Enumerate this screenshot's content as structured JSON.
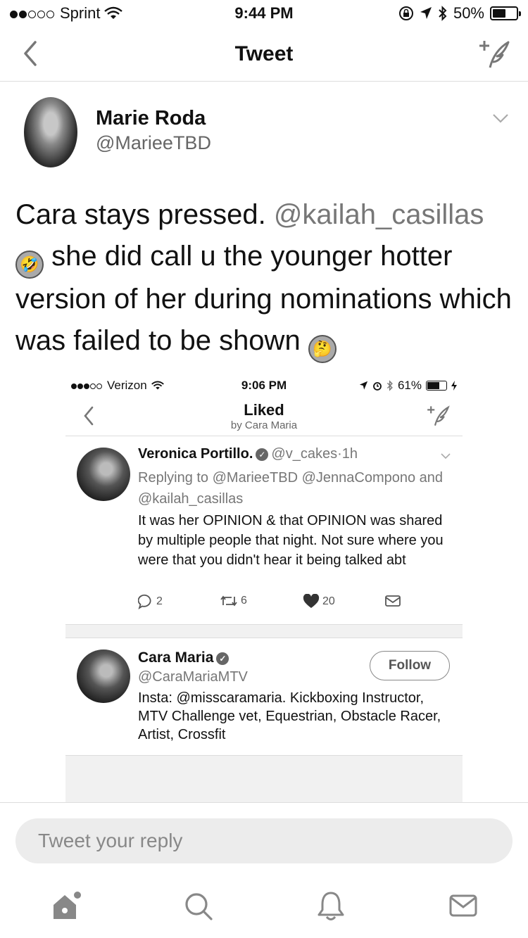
{
  "status_bar": {
    "carrier": "Sprint",
    "time": "9:44 PM",
    "battery": "50%",
    "battery_level": 0.5
  },
  "nav": {
    "title": "Tweet"
  },
  "tweet": {
    "author_name": "Marie Roda",
    "author_handle": "@MarieeTBD",
    "text_part1": "Cara stays pressed.",
    "mention": "@kailah_casillas",
    "text_part2": "she did call u the younger hotter version of her during nominations which was failed to be shown",
    "emoji1": "🤣",
    "emoji2": "🤔"
  },
  "embedded_screenshot": {
    "status_bar": {
      "carrier": "Verizon",
      "time": "9:06 PM",
      "battery": "61%",
      "battery_level": 0.61
    },
    "nav": {
      "title": "Liked",
      "subtitle": "by Cara Maria"
    },
    "reply_tweet": {
      "name": "Veronica Portillo.",
      "handle": "@v_cakes",
      "separator": "·",
      "age": "1h",
      "replying_to": "Replying to @MarieeTBD @JennaCompono and @kailah_casillas",
      "body": "It was her OPINION & that OPINION was shared by multiple people that night. Not sure where you were that you didn't hear it being talked abt",
      "replies": "2",
      "retweets": "6",
      "likes": "20"
    },
    "profile": {
      "name": "Cara Maria",
      "handle": "@CaraMariaMTV",
      "follow_label": "Follow",
      "bio": "Insta: @misscaramaria. Kickboxing Instructor, MTV Challenge vet, Equestrian, Obstacle Racer, Artist, Crossfit"
    }
  },
  "reply_bar": {
    "placeholder": "Tweet your reply"
  },
  "tab_bar": {
    "items": [
      "home-icon",
      "search-icon",
      "notifications-icon",
      "messages-icon"
    ]
  }
}
